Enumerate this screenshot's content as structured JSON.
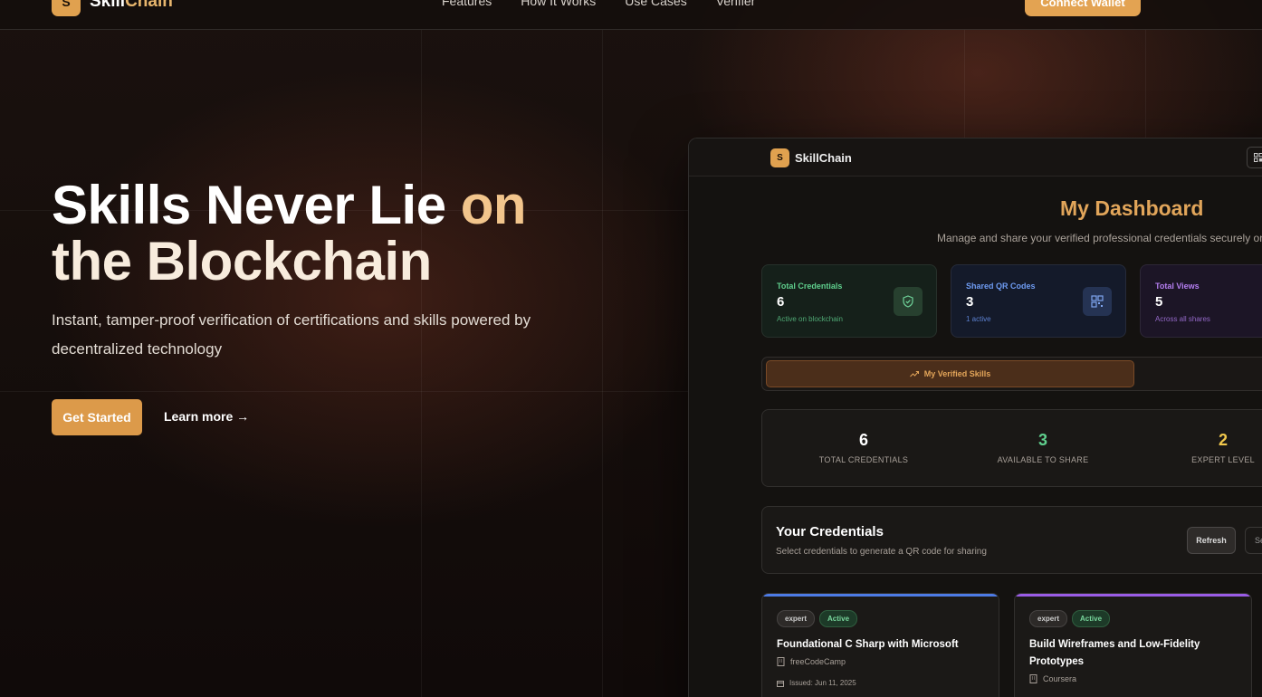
{
  "nav": {
    "brand_initial": "S",
    "brand_name_main": "Skill",
    "brand_name_accent": "Chain",
    "links": [
      "Features",
      "How It Works",
      "Use Cases",
      "Verifier"
    ],
    "connect_label": "Connect Wallet"
  },
  "hero": {
    "title_part1": "Skills Never Lie ",
    "title_accent": "on",
    "title_line2": "the Blockchain",
    "subtitle": "Instant, tamper-proof verification of certifications and skills powered by decentralized technology",
    "cta_primary": "Get Started",
    "cta_secondary": "Learn more →"
  },
  "dashboard": {
    "brand_initial": "S",
    "brand_name": "SkillChain",
    "title": "My Dashboard",
    "subtitle": "Manage and share your verified professional credentials securely on t",
    "stats": [
      {
        "label": "Total Credentials",
        "value": "6",
        "note": "Active on blockchain",
        "icon": "shield-check-icon"
      },
      {
        "label": "Shared QR Codes",
        "value": "3",
        "note": "1 active",
        "icon": "qr-code-icon"
      },
      {
        "label": "Total Views",
        "value": "5",
        "note": "Across all shares",
        "icon": "eye-icon"
      }
    ],
    "tab_active": "My Verified Skills",
    "summary": [
      {
        "value": "6",
        "label": "TOTAL CREDENTIALS"
      },
      {
        "value": "3",
        "label": "AVAILABLE TO SHARE"
      },
      {
        "value": "2",
        "label": "EXPERT LEVEL"
      }
    ],
    "credentials_section": {
      "title": "Your Credentials",
      "subtitle": "Select credentials to generate a QR code for sharing",
      "refresh_label": "Refresh",
      "select_label": "Se"
    },
    "credentials": [
      {
        "level": "expert",
        "status": "Active",
        "name": "Foundational C Sharp with Microsoft",
        "issuer": "freeCodeCamp",
        "issued": "Issued: Jun 11, 2025"
      },
      {
        "level": "expert",
        "status": "Active",
        "name": "Build Wireframes and Low-Fidelity Prototypes",
        "issuer": "Coursera"
      }
    ]
  },
  "colors": {
    "accent": "#e0a14f",
    "green": "#5fcf8d",
    "blue": "#6e9bf2",
    "purple": "#b47ef0",
    "yellow": "#f1c84c"
  }
}
